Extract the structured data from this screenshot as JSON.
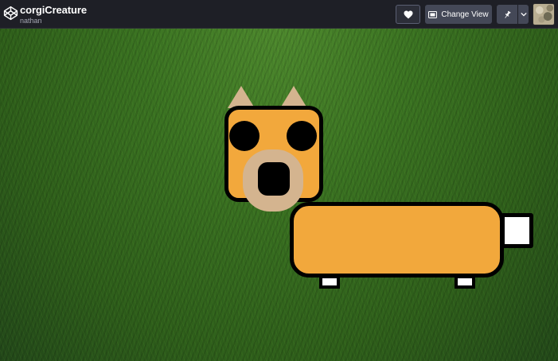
{
  "pen": {
    "title": "corgiCreature",
    "author": "nathan"
  },
  "toolbar": {
    "heart_icon": "heart-icon",
    "change_view_label": "Change View",
    "change_view_icon": "layout-icon",
    "pin_icon": "pin-icon",
    "caret_icon": "chevron-down-icon"
  },
  "colors": {
    "topbar_bg": "#1e1f26",
    "button_bg": "#444857",
    "corgi_orange": "#f2a83c",
    "corgi_tan": "#d4b48f",
    "outline": "#000000",
    "grass": "#3b7422"
  }
}
